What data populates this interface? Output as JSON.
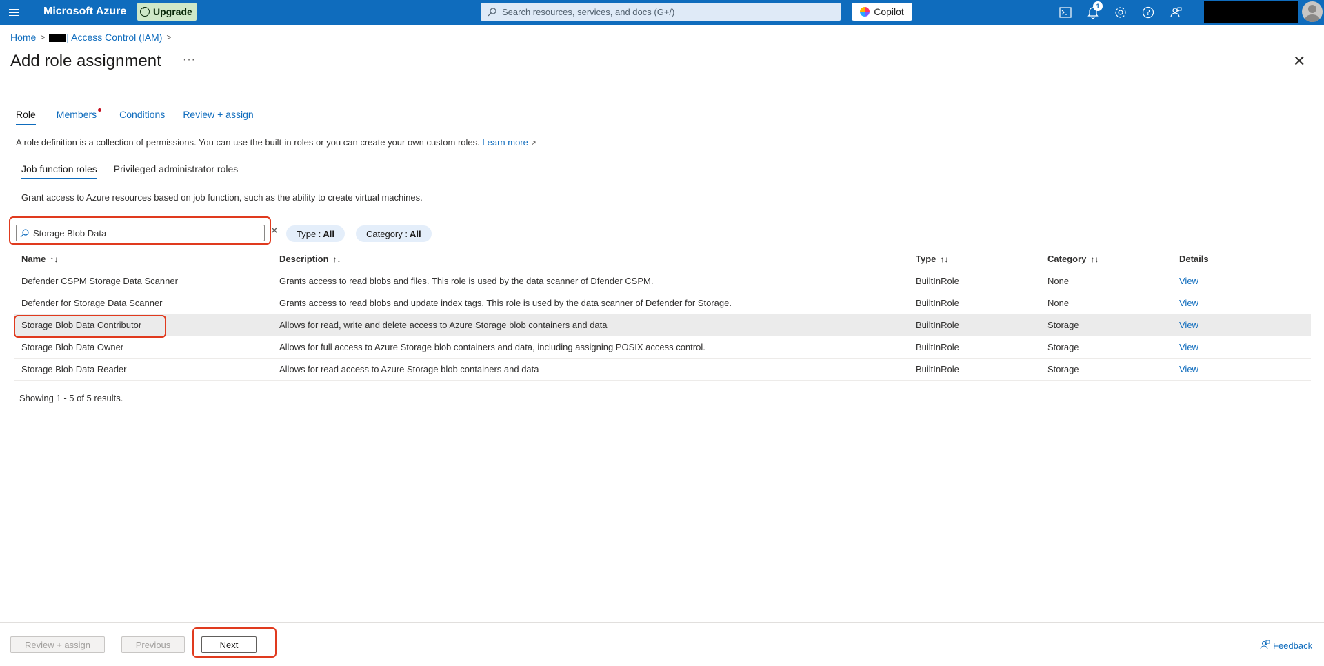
{
  "topbar": {
    "brand": "Microsoft Azure",
    "upgrade_label": "Upgrade",
    "search_placeholder": "Search resources, services, and docs (G+/)",
    "copilot_label": "Copilot",
    "notification_count": "1"
  },
  "breadcrumb": {
    "home": "Home",
    "resource": "| Access Control (IAM)"
  },
  "page": {
    "title": "Add role assignment",
    "more": "···"
  },
  "tabs": [
    {
      "label": "Role"
    },
    {
      "label": "Members"
    },
    {
      "label": "Conditions"
    },
    {
      "label": "Review + assign"
    }
  ],
  "description": {
    "text": "A role definition is a collection of permissions. You can use the built-in roles or you can create your own custom roles.",
    "learn_more": "Learn more"
  },
  "subtabs": [
    {
      "label": "Job function roles"
    },
    {
      "label": "Privileged administrator roles"
    }
  ],
  "grant_text": "Grant access to Azure resources based on job function, such as the ability to create virtual machines.",
  "filter": {
    "search_value": "Storage Blob Data",
    "type_label": "Type :",
    "type_value": "All",
    "category_label": "Category :",
    "category_value": "All"
  },
  "table": {
    "columns": [
      "Name",
      "Description",
      "Type",
      "Category",
      "Details"
    ],
    "rows": [
      {
        "name": "Defender CSPM Storage Data Scanner",
        "description": "Grants access to read blobs and files. This role is used by the data scanner of Dfender CSPM.",
        "type": "BuiltInRole",
        "category": "None",
        "details": "View"
      },
      {
        "name": "Defender for Storage Data Scanner",
        "description": "Grants access to read blobs and update index tags. This role is used by the data scanner of Defender for Storage.",
        "type": "BuiltInRole",
        "category": "None",
        "details": "View"
      },
      {
        "name": "Storage Blob Data Contributor",
        "description": "Allows for read, write and delete access to Azure Storage blob containers and data",
        "type": "BuiltInRole",
        "category": "Storage",
        "details": "View"
      },
      {
        "name": "Storage Blob Data Owner",
        "description": "Allows for full access to Azure Storage blob containers and data, including assigning POSIX access control.",
        "type": "BuiltInRole",
        "category": "Storage",
        "details": "View"
      },
      {
        "name": "Storage Blob Data Reader",
        "description": "Allows for read access to Azure Storage blob containers and data",
        "type": "BuiltInRole",
        "category": "Storage",
        "details": "View"
      }
    ],
    "selected_row": 2,
    "showing": "Showing 1 - 5 of 5 results."
  },
  "footer": {
    "review_assign": "Review + assign",
    "previous": "Previous",
    "next": "Next",
    "feedback": "Feedback"
  },
  "colors": {
    "azure_blue": "#0f6cbd",
    "highlight_red": "#e03a1e",
    "upgrade_bg": "#cfe8c8"
  }
}
